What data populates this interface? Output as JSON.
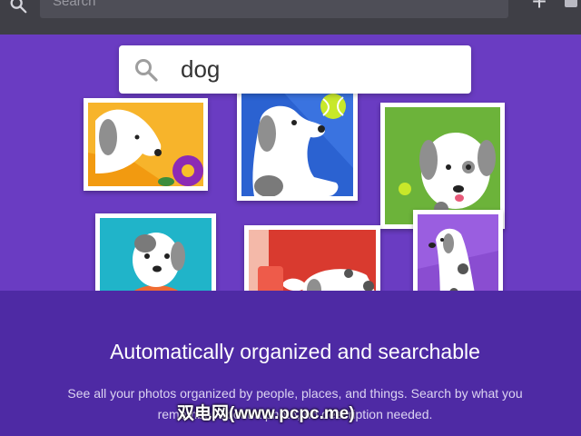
{
  "topbar": {
    "search_placeholder": "Search",
    "add_label": "+"
  },
  "search": {
    "query": "dog"
  },
  "footer": {
    "headline": "Automatically organized and searchable",
    "body": "See all your photos organized by people, places, and things. Search by what you remember about a photo, no description needed."
  },
  "watermark": "双电网(www.pcpc.me)",
  "colors": {
    "hero_background": "#6a3cc2",
    "footer_background": "#4e2aa4",
    "topbar_background": "#3f3f46"
  }
}
